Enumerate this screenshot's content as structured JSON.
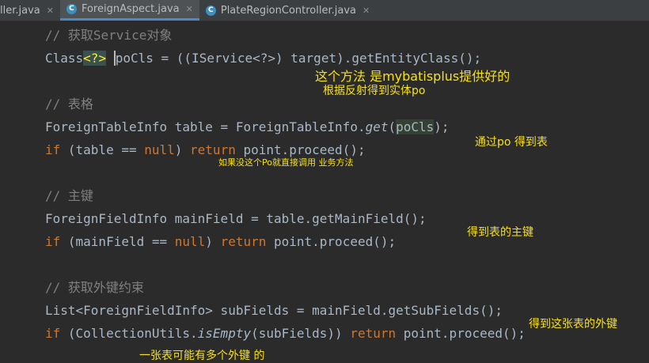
{
  "tabs": [
    {
      "label": "ller.java",
      "active": false,
      "has_icon": false
    },
    {
      "label": "ForeignAspect.java",
      "active": true,
      "has_icon": true
    },
    {
      "label": "PlateRegionController.java",
      "active": false,
      "has_icon": true
    }
  ],
  "tab_icon_letter": "C",
  "tab_close_glyph": "✕",
  "code": {
    "l1": {
      "comment": "// 获取Service对象"
    },
    "l2": {
      "t1": "Class",
      "t2": "<?>",
      "t3": " ",
      "t4": "poCls",
      "t5": " = ((IService<?>) target).getEntityClass();"
    },
    "l4": {
      "comment": "// 表格"
    },
    "l5": {
      "t1": "ForeignTableInfo table = ForeignTableInfo.",
      "t2": "get",
      "t3": "(",
      "t4": "poCls",
      "t5": ");"
    },
    "l6": {
      "k1": "if",
      "t1": " (table == ",
      "k2": "null",
      "t2": ") ",
      "k3": "return",
      "t3": " point.proceed();"
    },
    "l8": {
      "comment": "// 主键"
    },
    "l9": {
      "t1": "ForeignFieldInfo mainField = table.getMainField();"
    },
    "l10": {
      "k1": "if",
      "t1": " (mainField == ",
      "k2": "null",
      "t2": ") ",
      "k3": "return",
      "t3": " point.proceed();"
    },
    "l12": {
      "comment": "// 获取外键约束"
    },
    "l13": {
      "t1": "List<ForeignFieldInfo> subFields = mainField.getSubFields();"
    },
    "l14": {
      "k1": "if",
      "t1": " (CollectionUtils.",
      "t2": "isEmpty",
      "t3": "(subFields)) ",
      "k2": "return",
      "t4": " point.proceed();"
    }
  },
  "annotations": {
    "a1": "这个方法 是mybatisplus提供好的",
    "a2": "根据反射得到实体po",
    "a3": "通过po 得到表",
    "a4": "如果没这个Po就直接调用 业务方法",
    "a5": "得到表的主键",
    "a6": "得到这张表的外键",
    "a7": "一张表可能有多个外键 的"
  },
  "colors": {
    "background": "#2b2b2b",
    "keyword": "#cc7832",
    "comment": "#808080",
    "text": "#a9b7c6",
    "annotation": "#f7e016",
    "tab_accent": "#4a88c7"
  }
}
